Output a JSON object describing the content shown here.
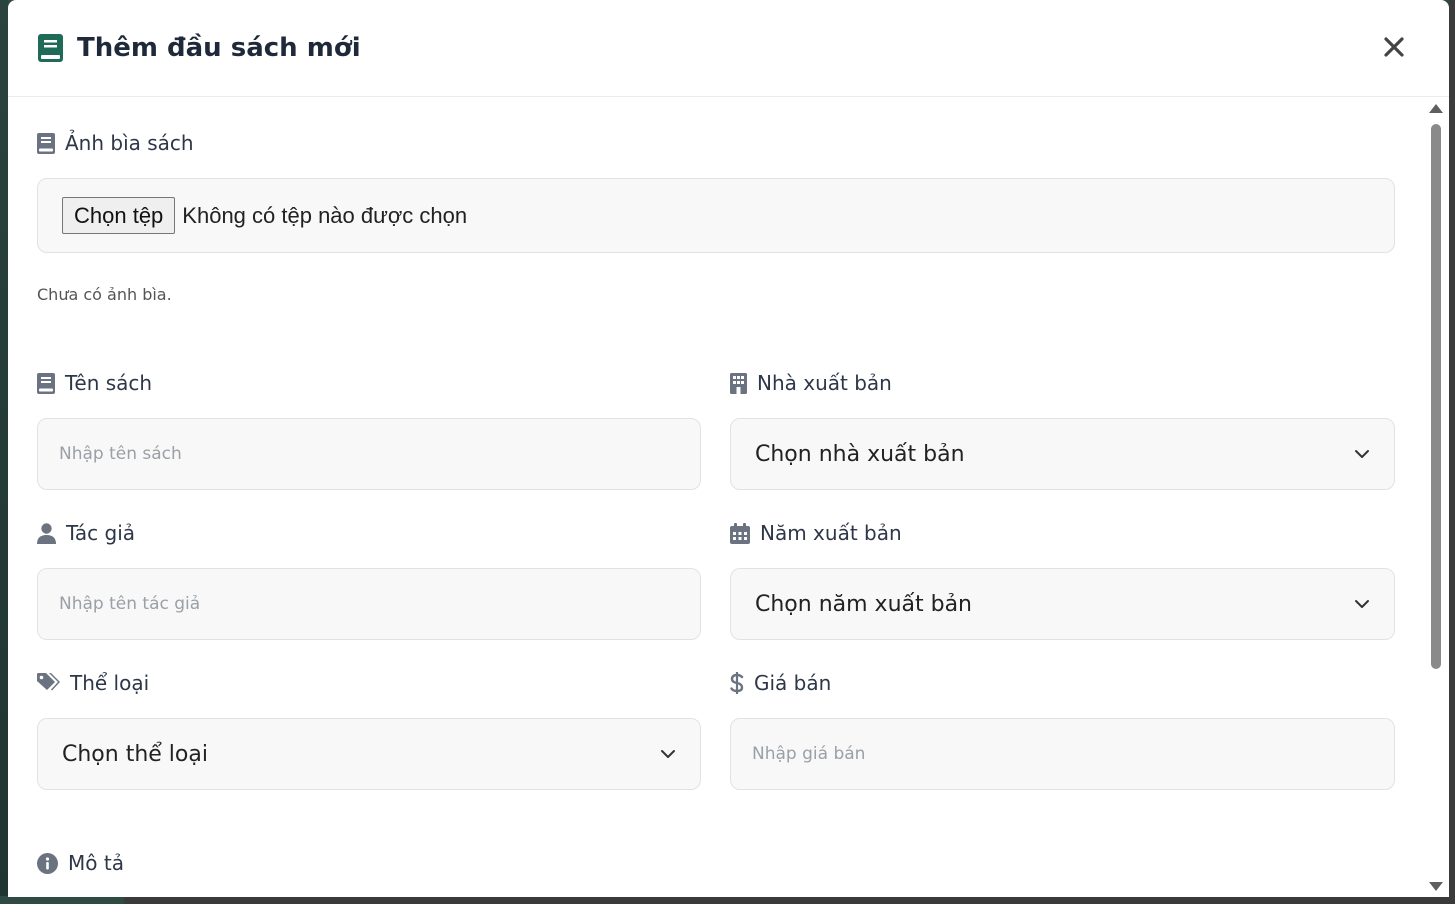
{
  "modal": {
    "title": "Thêm đầu sách mới",
    "close_icon": "close-icon",
    "title_icon": "book-icon"
  },
  "cover": {
    "label": "Ảnh bìa sách",
    "file_button": "Chọn tệp",
    "file_status": "Không có tệp nào được chọn",
    "hint": "Chưa có ảnh bìa."
  },
  "fields": {
    "title": {
      "label": "Tên sách",
      "placeholder": "Nhập tên sách",
      "icon": "book-icon"
    },
    "publisher": {
      "label": "Nhà xuất bản",
      "value": "Chọn nhà xuất bản",
      "icon": "building-icon"
    },
    "author": {
      "label": "Tác giả",
      "placeholder": "Nhập tên tác giả",
      "icon": "user-icon"
    },
    "year": {
      "label": "Năm xuất bản",
      "value": "Chọn năm xuất bản",
      "icon": "calendar-icon"
    },
    "genre": {
      "label": "Thể loại",
      "value": "Chọn thể loại",
      "icon": "tags-icon"
    },
    "price": {
      "label": "Giá bán",
      "placeholder": "Nhập giá bán",
      "icon": "dollar-icon"
    },
    "description": {
      "label": "Mô tả",
      "icon": "info-icon"
    }
  },
  "colors": {
    "accent": "#1f6b57",
    "label_icon": "#6b7280",
    "title_text": "#1e2a3a"
  }
}
